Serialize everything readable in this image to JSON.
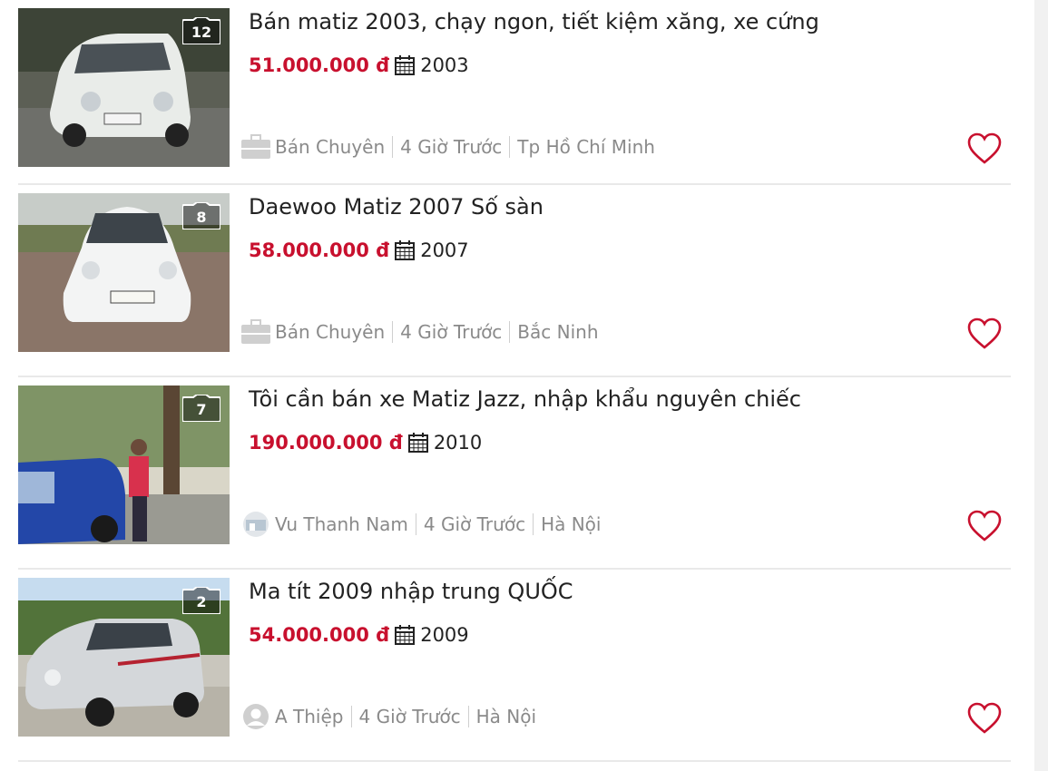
{
  "listings": [
    {
      "title": "Bán matiz 2003, chạy ngon, tiết kiệm xăng, xe cứng",
      "price": "51.000.000 đ",
      "year": "2003",
      "photo_count": "12",
      "seller": "Bán Chuyên",
      "posted": "4 Giờ Trước",
      "location": "Tp Hồ Chí Minh",
      "seller_icon": "briefcase-icon"
    },
    {
      "title": "Daewoo Matiz 2007 Số sàn",
      "price": "58.000.000 đ",
      "year": "2007",
      "photo_count": "8",
      "seller": "Bán Chuyên",
      "posted": "4 Giờ Trước",
      "location": "Bắc Ninh",
      "seller_icon": "briefcase-icon"
    },
    {
      "title": "Tôi cần bán xe Matiz Jazz, nhập khẩu nguyên chiếc",
      "price": "190.000.000 đ",
      "year": "2010",
      "photo_count": "7",
      "seller": "Vu Thanh Nam",
      "posted": "4 Giờ Trước",
      "location": "Hà Nội",
      "seller_icon": "user-photo-avatar"
    },
    {
      "title": "Ma tít 2009 nhập trung QUỐC",
      "price": "54.000.000 đ",
      "year": "2009",
      "photo_count": "2",
      "seller": "A Thiệp",
      "posted": "4 Giờ Trước",
      "location": "Hà Nội",
      "seller_icon": "default-avatar-icon"
    }
  ],
  "colors": {
    "price": "#c8102e",
    "heart": "#c8102e",
    "meta_text": "#8a8a8a",
    "divider": "#e9e9e9"
  }
}
